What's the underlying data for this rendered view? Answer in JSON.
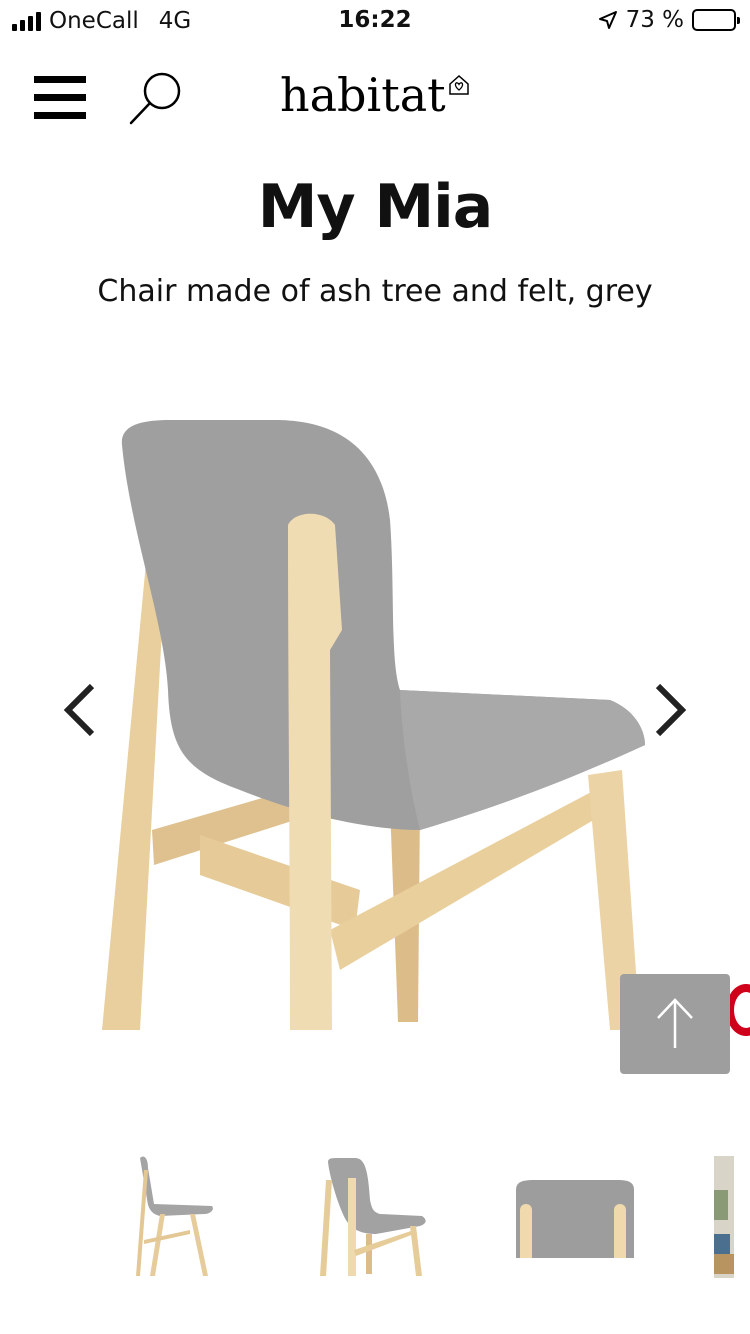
{
  "status_bar": {
    "carrier": "OneCall",
    "network": "4G",
    "time": "16:22",
    "battery": "73 %",
    "battery_level": 0.73
  },
  "header": {
    "logo": "habitat",
    "menu_icon": "hamburger-menu-icon",
    "search_icon": "search-icon"
  },
  "product": {
    "title": "My Mia",
    "subtitle": "Chair made of ash tree and felt, grey"
  },
  "colors": {
    "felt": "#9c9c9c",
    "wood": "#ead3a6",
    "scroll_button": "#9e9e9e",
    "badge": "#d0021b"
  }
}
